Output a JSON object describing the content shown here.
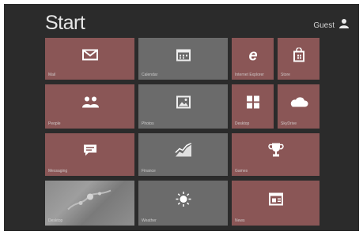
{
  "start": {
    "title": "Start",
    "user_name": "Guest"
  },
  "tiles": [
    {
      "name": "mail",
      "label": "Mail",
      "icon": "mail-icon"
    },
    {
      "name": "calendar",
      "label": "Calendar",
      "icon": "calendar-icon"
    },
    {
      "name": "internet-explorer",
      "label": "Internet Explorer",
      "icon": "internet-explorer-icon"
    },
    {
      "name": "store",
      "label": "Store",
      "icon": "store-icon"
    },
    {
      "name": "people",
      "label": "People",
      "icon": "people-icon"
    },
    {
      "name": "photos",
      "label": "Photos",
      "icon": "photos-icon"
    },
    {
      "name": "windows",
      "label": "Desktop",
      "icon": "windows-icon"
    },
    {
      "name": "skydrive",
      "label": "SkyDrive",
      "icon": "cloud-icon"
    },
    {
      "name": "messaging",
      "label": "Messaging",
      "icon": "chat-icon"
    },
    {
      "name": "finance",
      "label": "Finance",
      "icon": "chart-icon"
    },
    {
      "name": "games",
      "label": "Games",
      "icon": "trophy-icon"
    },
    {
      "name": "desktop",
      "label": "Desktop",
      "icon": "picture-icon"
    },
    {
      "name": "weather",
      "label": "Weather",
      "icon": "sun-icon"
    },
    {
      "name": "news",
      "label": "News",
      "icon": "news-icon"
    }
  ],
  "colors": {
    "background": "#2b2b2b",
    "tile_red": "#8a5656",
    "tile_gray": "#6b6b6b"
  }
}
